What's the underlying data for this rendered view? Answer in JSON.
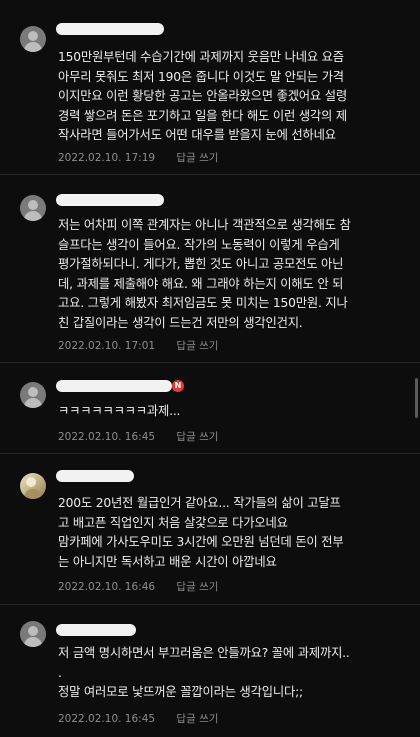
{
  "comments": [
    {
      "text": "150만원부턴데 수습기간에 과제까지 웃음만 나네요 요즘\n아무리 못줘도 최저 190은 줍니다 이것도 말 안되는 가격\n이지만요 이런 황당한 공고는 안올라왔으면 좋겠어요 설령\n경력 쌓으려 돈은 포기하고 일을 한다 해도 이런 생각의 제\n작사라면 들어가서도 어떤 대우를 받을지 눈에 선하네요",
      "date": "2022.02.10. 17:19",
      "reply": "답글 쓰기"
    },
    {
      "text": "저는 어차피 이쪽 관계자는 아니나 객관적으로 생각해도 참\n슬프다는 생각이 들어요. 작가의 노동력이 이렇게 우습게\n평가절하되다니. 게다가, 뽑힌 것도 아니고 공모전도 아닌\n데, 과제를 제출해야 해요. 왜 그래야 하는지 이해도 안 되\n고요. 그렇게 해봤자 최저임금도 못 미치는 150만원. 지나\n친 갑질이라는 생각이 드는건 저만의 생각인건지.",
      "date": "2022.02.10. 17:01",
      "reply": "답글 쓰기"
    },
    {
      "text": "ㅋㅋㅋㅋㅋㅋㅋㅋ과제...",
      "date": "2022.02.10. 16:45",
      "reply": "답글 쓰기",
      "badge": "N"
    },
    {
      "text": "200도 20년전 월급인거 같아요... 작가들의 삶이 고달프\n고 배고픈 직업인지 처음 살갗으로 다가오네요\n맘카페에 가사도우미도 3시간에 오만원 넘던데 돈이 전부\n는 아니지만 독서하고 배운 시간이 아깝네요",
      "date": "2022.02.10. 16:46",
      "reply": "답글 쓰기"
    },
    {
      "text": "저 금액 명시하면서 부끄러움은 안들까요? 꼴에 과제까지..\n.\n정말 여러모로 낯뜨꺼운 꼴깝이라는 생각입니다;;",
      "date": "2022.02.10. 16:45",
      "reply": "답글 쓰기"
    }
  ]
}
